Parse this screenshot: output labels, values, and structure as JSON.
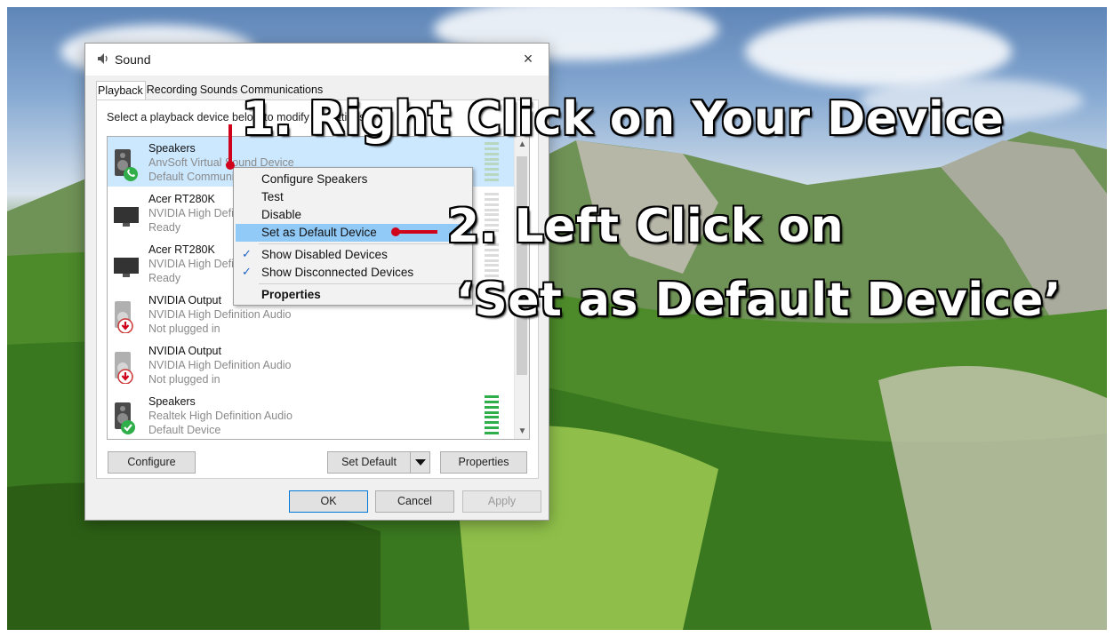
{
  "dialog": {
    "title": "Sound",
    "close_glyph": "×",
    "tabs": [
      "Playback",
      "Recording",
      "Sounds",
      "Communications"
    ],
    "active_tab": "Playback",
    "instruction": "Select a playback device below to modify its settings:",
    "devices": [
      {
        "name": "Speakers",
        "desc": "AnvSoft Virtual Sound Device",
        "status": "Default Communications Device",
        "icon": "speaker-icon",
        "badge": "phone-badge-icon",
        "selected": true
      },
      {
        "name": "Acer RT280K",
        "desc": "NVIDIA High Definition Audio",
        "status": "Ready",
        "icon": "monitor-icon",
        "badge": null,
        "selected": false
      },
      {
        "name": "Acer RT280K",
        "desc": "NVIDIA High Definition Audio",
        "status": "Ready",
        "icon": "monitor-icon",
        "badge": null,
        "selected": false
      },
      {
        "name": "NVIDIA Output",
        "desc": "NVIDIA High Definition Audio",
        "status": "Not plugged in",
        "icon": "speaker-icon",
        "badge": "down-arrow-badge-icon",
        "selected": false
      },
      {
        "name": "NVIDIA Output",
        "desc": "NVIDIA High Definition Audio",
        "status": "Not plugged in",
        "icon": "speaker-icon",
        "badge": "down-arrow-badge-icon",
        "selected": false
      },
      {
        "name": "Speakers",
        "desc": "Realtek High Definition Audio",
        "status": "Default Device",
        "icon": "speaker-icon",
        "badge": "check-badge-icon",
        "selected": false
      }
    ],
    "buttons": {
      "configure": "Configure",
      "set_default": "Set Default",
      "properties": "Properties",
      "ok": "OK",
      "cancel": "Cancel",
      "apply": "Apply"
    }
  },
  "context_menu": {
    "items": [
      {
        "label": "Configure Speakers",
        "checked": false,
        "bold": false,
        "highlighted": false
      },
      {
        "label": "Test",
        "checked": false,
        "bold": false,
        "highlighted": false
      },
      {
        "label": "Disable",
        "checked": false,
        "bold": false,
        "highlighted": false
      },
      {
        "label": "Set as Default Device",
        "checked": false,
        "bold": false,
        "highlighted": true
      },
      {
        "label": "Show Disabled Devices",
        "checked": true,
        "bold": false,
        "highlighted": false
      },
      {
        "label": "Show Disconnected Devices",
        "checked": true,
        "bold": false,
        "highlighted": false
      },
      {
        "label": "Properties",
        "checked": false,
        "bold": true,
        "highlighted": false
      }
    ]
  },
  "annotations": {
    "step1": "1. Right Click on Your Device",
    "step2_line1": "2. Left Click on",
    "step2_line2": "‘Set as Default Device’",
    "marker_color": "#d0021b"
  },
  "colors": {
    "selected_row": "#cce8ff",
    "menu_highlight": "#91c9f7",
    "meter_green": "#2fae4a"
  }
}
